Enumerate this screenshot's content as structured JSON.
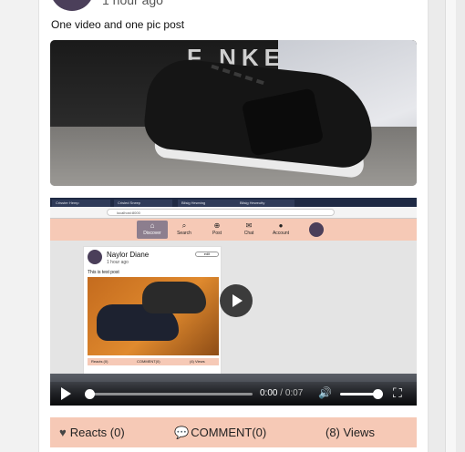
{
  "post": {
    "time": "1 hour ago",
    "caption": "One video and one pic post",
    "photo": {
      "brand_text": "F NKELS"
    }
  },
  "video": {
    "recording": {
      "tabs": [
        "Crisster Hemp",
        "Crisled Sneep",
        "Bilsig Hewning",
        "Bilsig Heweutty"
      ],
      "url": "localhost:8000",
      "nav": [
        {
          "label": "Discover",
          "icon": "⌂"
        },
        {
          "label": "Search",
          "icon": "⌕"
        },
        {
          "label": "Post",
          "icon": "⊕"
        },
        {
          "label": "Chat",
          "icon": "✉"
        },
        {
          "label": "Account",
          "icon": "●"
        }
      ],
      "card": {
        "name": "Naylor Diane",
        "time": "1 hour ago",
        "edit": "edit",
        "text": "This is test post",
        "reacts": "Reacts (0)",
        "comments": "COMMENT(0)",
        "views": "(4) Views"
      }
    },
    "controls": {
      "current_time": "0:00",
      "separator": " / ",
      "duration": "0:07",
      "progress": 0.0,
      "volume": 0.95
    }
  },
  "actions": {
    "reacts": "Reacts (0)",
    "comments": "COMMENT(0)",
    "views": "(8) Views"
  },
  "icons": {
    "heart": "heart-icon",
    "comment": "comment-icon",
    "play": "play-icon",
    "volume": "volume-icon",
    "fullscreen": "fullscreen-icon"
  },
  "colors": {
    "accent": "#f6c9b6",
    "avatar": "#4b3f5a"
  }
}
